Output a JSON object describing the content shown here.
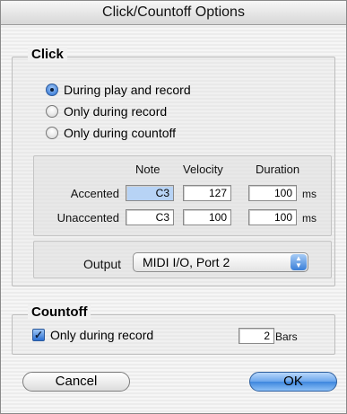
{
  "window": {
    "title": "Click/Countoff Options"
  },
  "click": {
    "title": "Click",
    "options": [
      {
        "label": "During play and record",
        "checked": true
      },
      {
        "label": "Only during record",
        "checked": false
      },
      {
        "label": "Only during countoff",
        "checked": false
      }
    ],
    "columns": {
      "note": "Note",
      "velocity": "Velocity",
      "duration": "Duration"
    },
    "rows": [
      {
        "label": "Accented",
        "note": "C3",
        "velocity": "127",
        "duration": "100",
        "unit": "ms"
      },
      {
        "label": "Unaccented",
        "note": "C3",
        "velocity": "100",
        "duration": "100",
        "unit": "ms"
      }
    ],
    "output": {
      "label": "Output",
      "value": "MIDI I/O, Port 2"
    }
  },
  "countoff": {
    "title": "Countoff",
    "only_during_record": {
      "label": "Only during record",
      "checked": true
    },
    "bars": {
      "value": "2",
      "unit": "Bars"
    }
  },
  "buttons": {
    "cancel": "Cancel",
    "ok": "OK"
  },
  "colors": {
    "accent": "#3d86de",
    "selected_field": "#b7d3f5"
  }
}
